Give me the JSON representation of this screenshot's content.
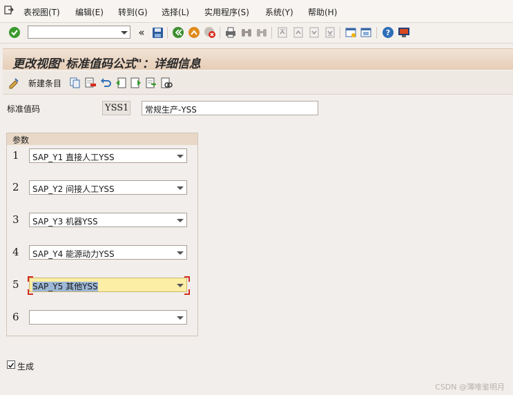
{
  "menu": {
    "items": [
      "表视图(T)",
      "编辑(E)",
      "转到(G)",
      "选择(L)",
      "实用程序(S)",
      "系统(Y)",
      "帮助(H)"
    ]
  },
  "toolbar": {
    "command_value": ""
  },
  "title": "更改视图\"标准值码公式\"：详细信息",
  "app_toolbar": {
    "new_entries_label": "新建条目"
  },
  "fields": {
    "label": "标准值码",
    "code": "YSS1",
    "description": "常规生产-YSS"
  },
  "params": {
    "group_title": "参数",
    "rows": [
      {
        "num": "1",
        "value": "SAP_Y1 直接人工YSS"
      },
      {
        "num": "2",
        "value": "SAP_Y2 间接人工YSS"
      },
      {
        "num": "3",
        "value": "SAP_Y3 机器YSS"
      },
      {
        "num": "4",
        "value": "SAP_Y4 能源动力YSS"
      },
      {
        "num": "5",
        "value": "SAP_Y5 其他YSS"
      },
      {
        "num": "6",
        "value": ""
      }
    ]
  },
  "generate": {
    "label": "生成",
    "checked": true
  },
  "watermark": "CSDN @薄唯鉴明月"
}
